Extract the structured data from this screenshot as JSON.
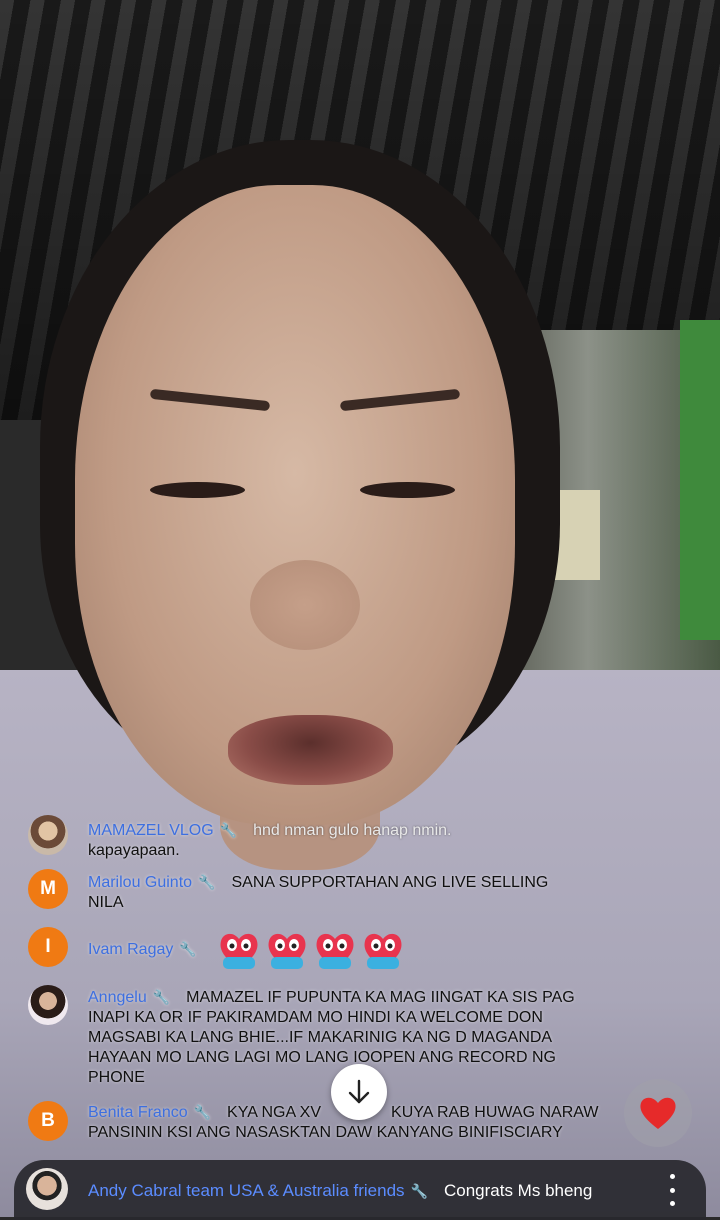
{
  "comments": [
    {
      "avatar_type": "photo",
      "avatar_letter": "",
      "username": "MAMAZEL VLOG",
      "text": "hnd nman gulo hanap nmin.",
      "text_line2": "kapayapaan."
    },
    {
      "avatar_type": "letter",
      "avatar_letter": "M",
      "username": "Marilou Guinto",
      "text": "SANA SUPPORTAHAN ANG LIVE SELLING",
      "text_line2": "NILA"
    },
    {
      "avatar_type": "letter",
      "avatar_letter": "I",
      "username": "Ivam Ragay",
      "text": "",
      "emoji_count": 4
    },
    {
      "avatar_type": "photo",
      "avatar_letter": "",
      "username": "Anngelu",
      "text": "MAMAZEL IF PUPUNTA KA MAG IINGAT KA SIS",
      "text_rest": "PAG INAPI KA OR IF PAKIRAMDAM MO HINDI KA WELCOME DON MAGSABI KA LANG BHIE...IF MAKARINIG KA NG D MAGANDA HAYAAN MO LANG LAGI MO LANG IOOPEN ANG RECORD NG PHONE"
    },
    {
      "avatar_type": "letter",
      "avatar_letter": "B",
      "username": "Benita Franco",
      "text": "KYA NGA XV",
      "text_after": "KUYA RAB HUWAG NARAW",
      "text_line2": "PANSININ KSI ANG NASASKTAN DAW KANYANG BINIFISCIARY"
    }
  ],
  "bottom_bar": {
    "username": "Andy Cabral team USA & Australia friends",
    "text": "Congrats Ms bheng"
  },
  "icons": {
    "wrench": "wrench-icon",
    "scroll_down": "arrow-down-icon",
    "like": "heart-icon",
    "more": "more-vertical-icon",
    "emoji": "heart-face-emoji"
  },
  "colors": {
    "username": "#3d6fe0",
    "avatar_orange": "#f07a13",
    "like_heart": "#e62a2a"
  }
}
